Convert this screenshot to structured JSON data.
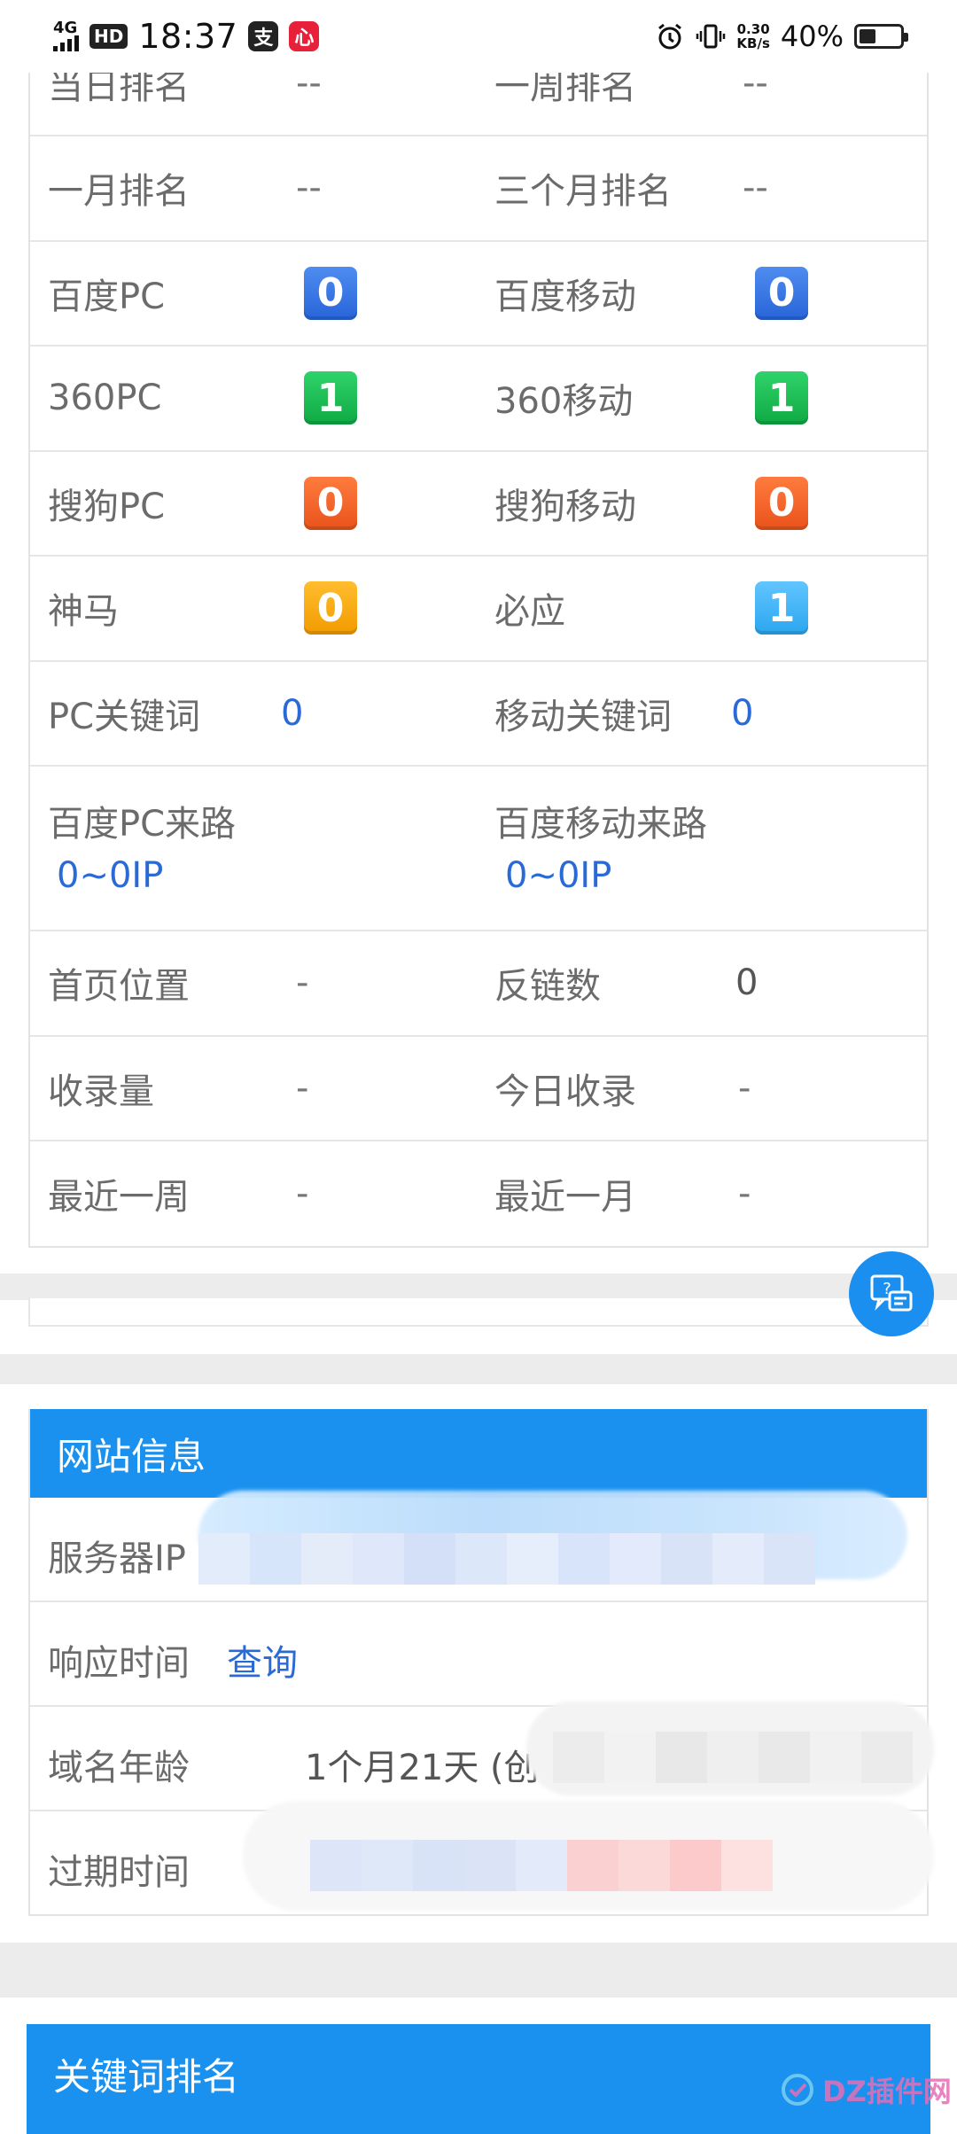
{
  "status_bar": {
    "network": "4G",
    "hd": "HD",
    "time": "18:37",
    "app_icons": [
      "支",
      "心"
    ],
    "speed_value": "0.30",
    "speed_unit": "KB/s",
    "battery": "40%",
    "battery_level": 0.4
  },
  "ranking": {
    "top_partial": [
      {
        "label": "当日排名",
        "value": "--"
      },
      {
        "label": "一周排名",
        "value": "--"
      }
    ],
    "rows": [
      [
        {
          "label": "一月排名",
          "value": "--"
        },
        {
          "label": "三个月排名",
          "value": "--"
        }
      ],
      [
        {
          "label": "百度PC",
          "badge": "0",
          "color": "blue"
        },
        {
          "label": "百度移动",
          "badge": "0",
          "color": "blue"
        }
      ],
      [
        {
          "label": "360PC",
          "badge": "1",
          "color": "green"
        },
        {
          "label": "360移动",
          "badge": "1",
          "color": "green"
        }
      ],
      [
        {
          "label": "搜狗PC",
          "badge": "0",
          "color": "orange"
        },
        {
          "label": "搜狗移动",
          "badge": "0",
          "color": "orange"
        }
      ],
      [
        {
          "label": "神马",
          "badge": "0",
          "color": "yellow"
        },
        {
          "label": "必应",
          "badge": "1",
          "color": "lightblue"
        }
      ],
      [
        {
          "label": "PC关键词",
          "value": "0"
        },
        {
          "label": "移动关键词",
          "value": "0"
        }
      ]
    ],
    "traffic": [
      {
        "label": "百度PC来路",
        "value": "0~0IP"
      },
      {
        "label": "百度移动来路",
        "value": "0~0IP"
      }
    ],
    "rows2": [
      [
        {
          "label": "首页位置",
          "value": "-"
        },
        {
          "label": "反链数",
          "value": "0"
        }
      ],
      [
        {
          "label": "收录量",
          "value": "-"
        },
        {
          "label": "今日收录",
          "value": "-"
        }
      ],
      [
        {
          "label": "最近一周",
          "value": "-"
        },
        {
          "label": "最近一月",
          "value": "-"
        }
      ]
    ]
  },
  "site_info": {
    "title": "网站信息",
    "server_ip_label": "服务器IP",
    "response_label": "响应时间",
    "response_link": "查询",
    "domain_age_label": "域名年龄",
    "domain_age_value": "1个月21天 (创",
    "expire_label": "过期时间"
  },
  "keyword_ranking": {
    "title": "关键词排名"
  },
  "watermark": "DZ插件网",
  "colors": {
    "accent": "#1a91ee",
    "link": "#2a6ad6",
    "badge_blue": "#2f6fe0",
    "badge_green": "#16b24e",
    "badge_orange": "#f06226",
    "badge_yellow": "#f6a40a",
    "badge_lightblue": "#35aef3"
  }
}
